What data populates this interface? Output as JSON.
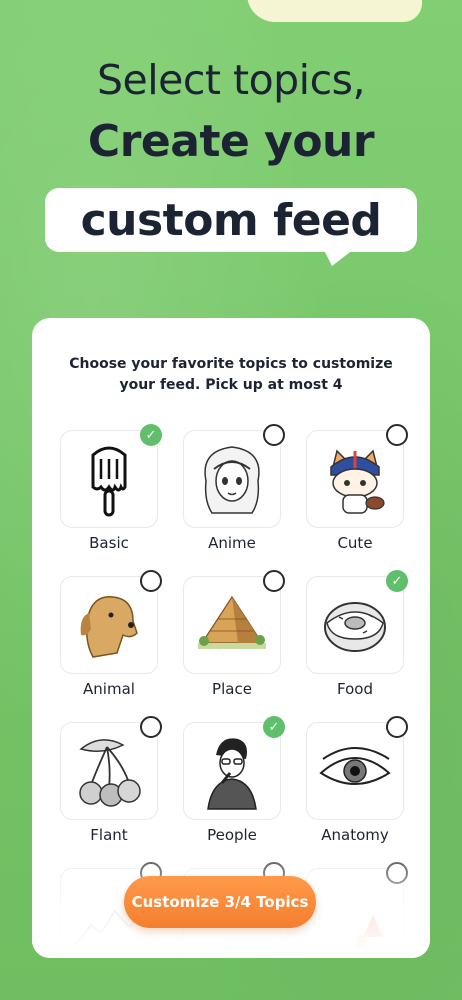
{
  "headline": {
    "line1": "Select topics,",
    "line2": "Create your",
    "line3": "custom feed"
  },
  "card": {
    "instructions": "Choose your favorite topics to customize your feed. Pick up at most 4",
    "topics": [
      {
        "label": "Basic",
        "selected": true,
        "icon": "popsicle-icon"
      },
      {
        "label": "Anime",
        "selected": false,
        "icon": "anime-girl-icon"
      },
      {
        "label": "Cute",
        "selected": false,
        "icon": "cute-cat-icon"
      },
      {
        "label": "Animal",
        "selected": false,
        "icon": "dog-icon"
      },
      {
        "label": "Place",
        "selected": false,
        "icon": "pyramid-icon"
      },
      {
        "label": "Food",
        "selected": true,
        "icon": "donut-icon"
      },
      {
        "label": "Flant",
        "selected": false,
        "icon": "cherries-icon"
      },
      {
        "label": "People",
        "selected": true,
        "icon": "person-icon"
      },
      {
        "label": "Anatomy",
        "selected": false,
        "icon": "eye-icon"
      }
    ],
    "cta_label": "Customize 3/4 Topics"
  },
  "colors": {
    "background": "#79c86b",
    "accent": "#f57e2f",
    "check": "#5fbf6b",
    "text": "#1c2433"
  }
}
